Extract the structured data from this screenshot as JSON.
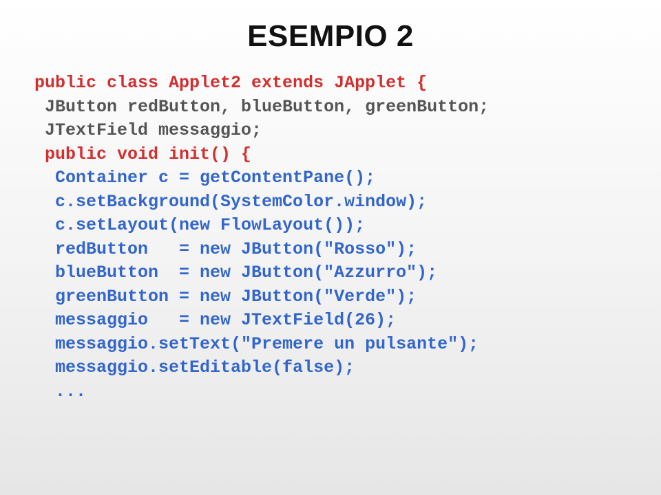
{
  "title": "ESEMPIO 2",
  "code": {
    "l1a": "public class Applet2 extends JApplet {",
    "l2a": " JButton redButton, blueButton, greenButton;",
    "l3a": " JTextField messaggio;",
    "l4a": " public void init() {",
    "l5a": "  Container c = getContentPane();",
    "l6a": "  c.setBackground(SystemColor.window);",
    "l7a": "  c.setLayout(new FlowLayout());",
    "l8a": "  redButton   = new JButton(\"Rosso\");",
    "l9a": "  blueButton  = new JButton(\"Azzurro\");",
    "l10a": "  greenButton = new JButton(\"Verde\");",
    "l11a": "  messaggio   = new JTextField(26);",
    "l12a": "  messaggio.setText(\"Premere un pulsante\");",
    "l13a": "  messaggio.setEditable(false);",
    "l14a": "  ..."
  }
}
